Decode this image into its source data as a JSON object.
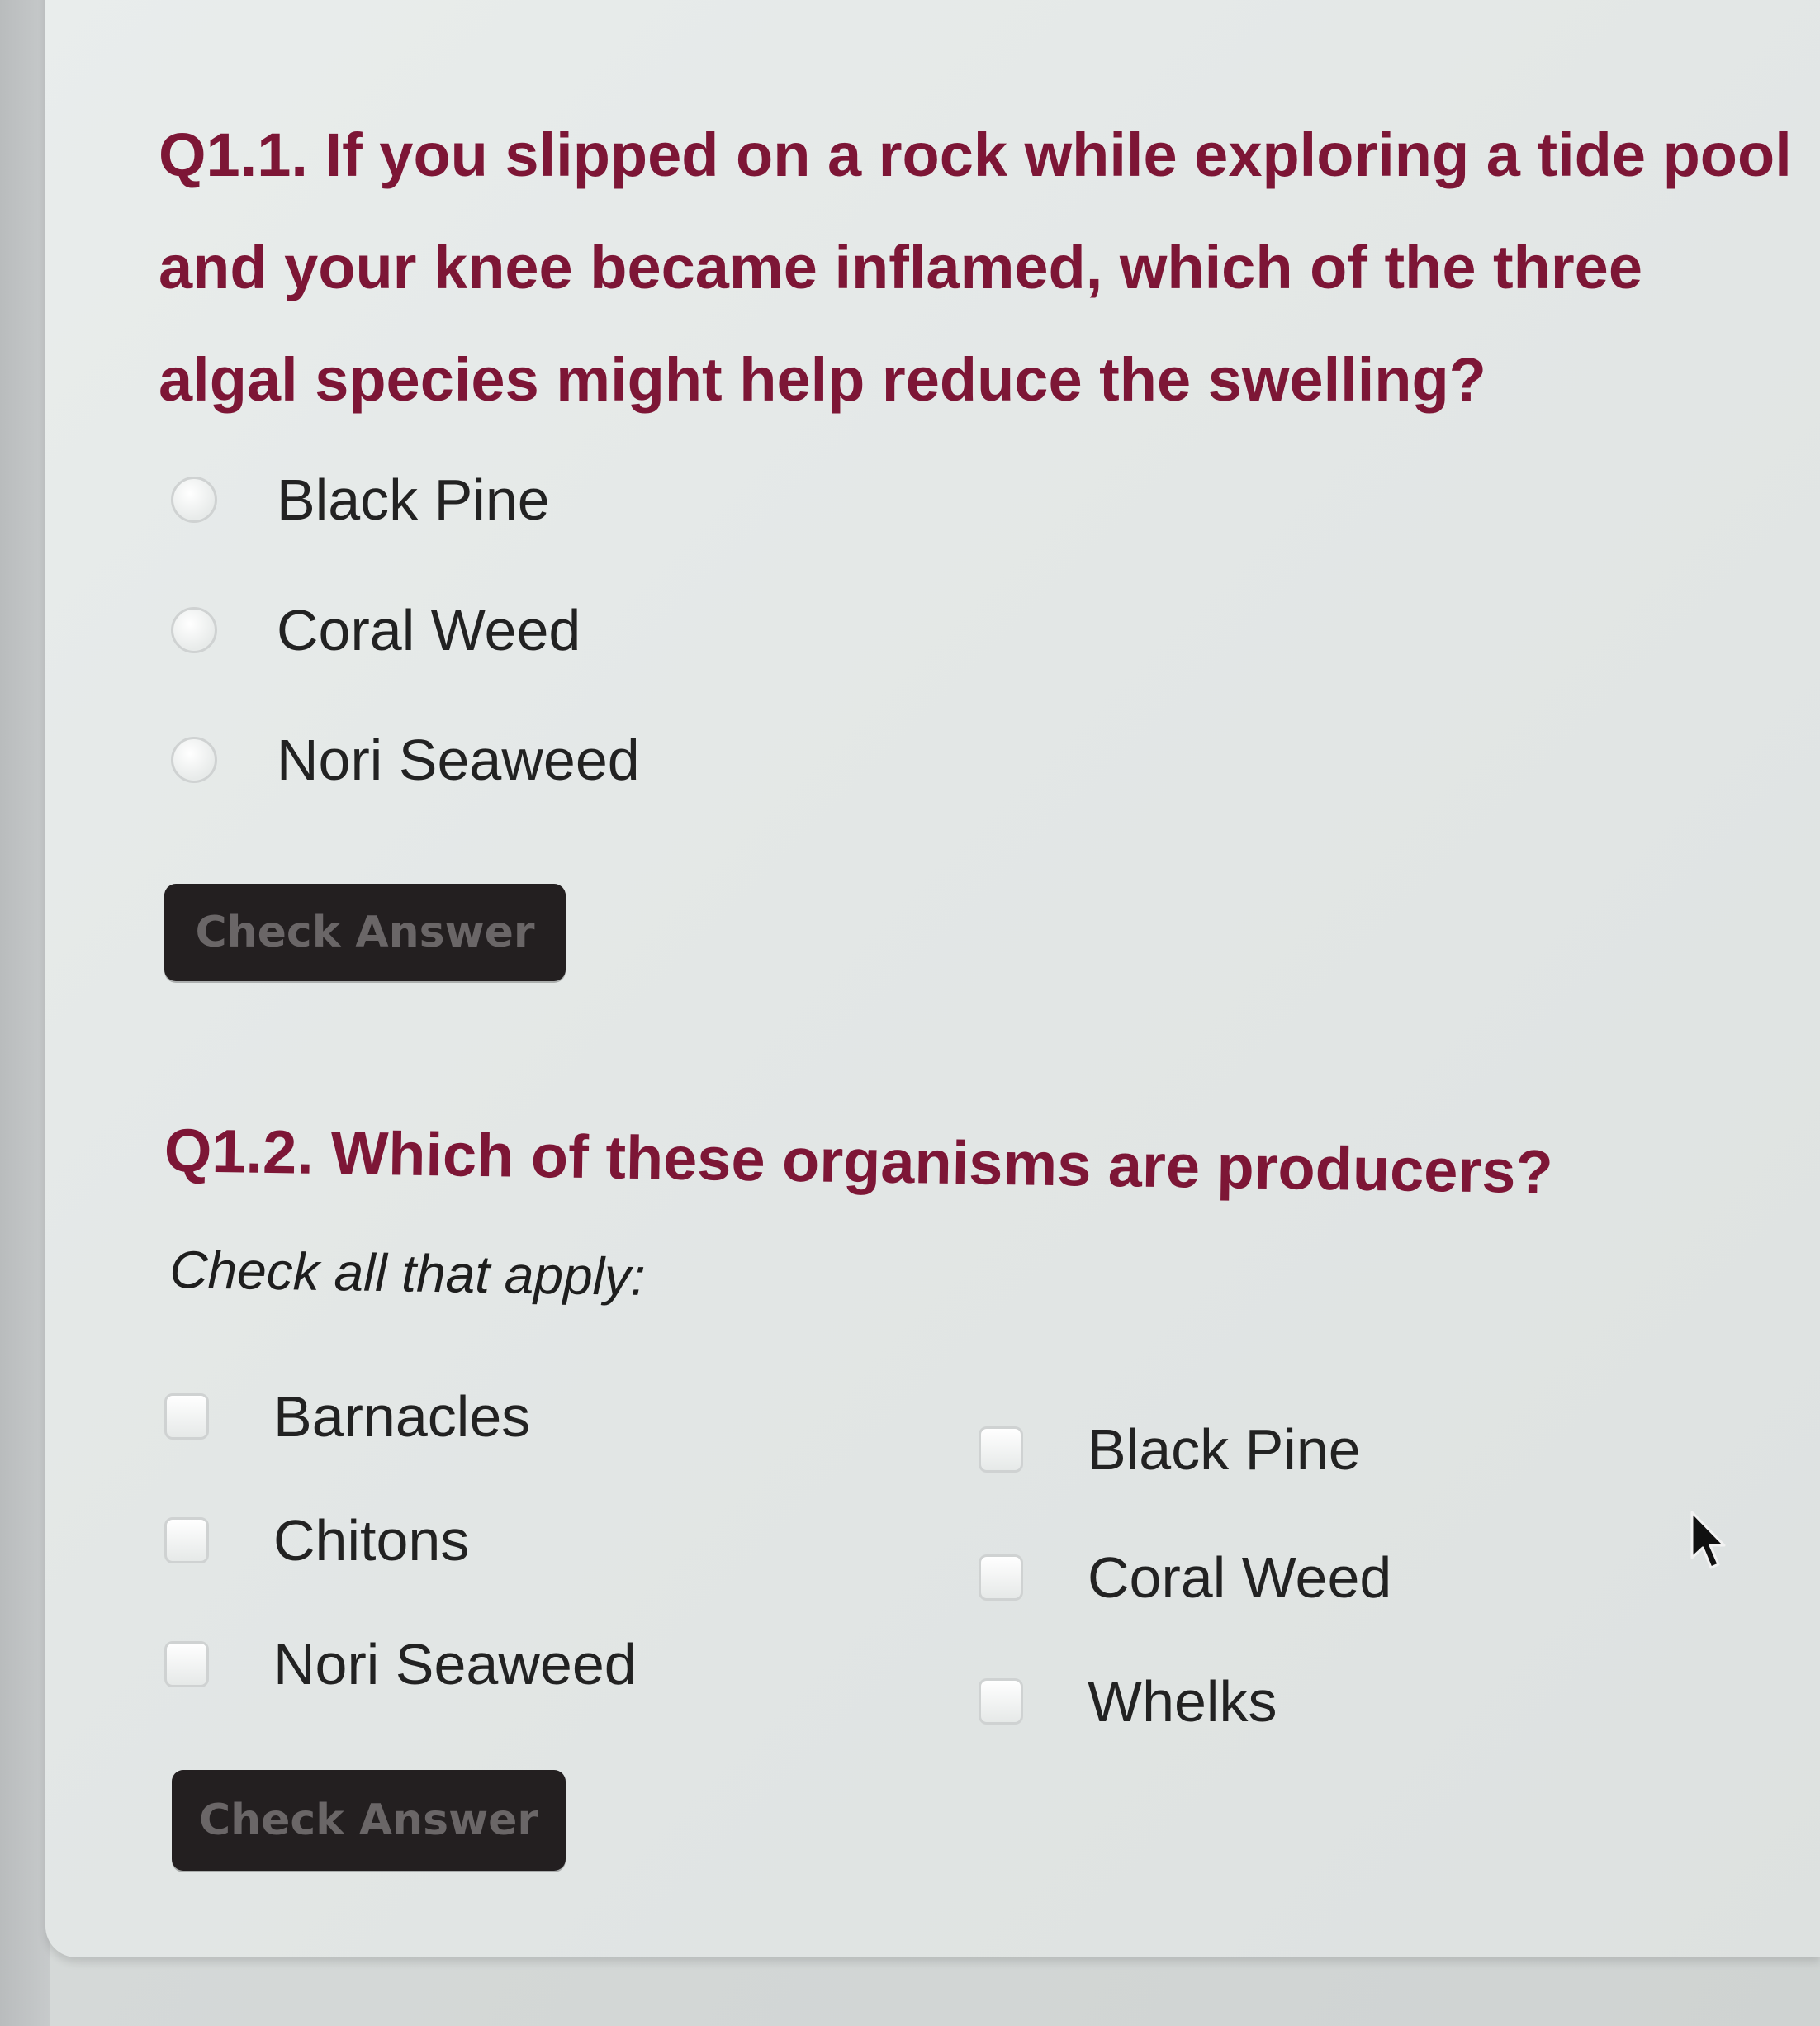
{
  "q1": {
    "title": "Q1.1. If you slipped on a rock while exploring a tide pool and your knee became inflamed, which of the three algal species might help reduce the swelling?",
    "options": [
      "Black Pine",
      "Coral Weed",
      "Nori Seaweed"
    ],
    "button_label": "Check Answer"
  },
  "q2": {
    "title": "Q1.2. Which of these organisms are producers?",
    "instruction": "Check all that apply:",
    "options_left": [
      "Barnacles",
      "Chitons",
      "Nori Seaweed"
    ],
    "options_right": [
      "Black Pine",
      "Coral Weed",
      "Whelks"
    ],
    "button_label": "Check Answer"
  },
  "colors": {
    "question_text": "#7d1636",
    "button_bg": "#231f20",
    "button_text": "#6a6667"
  },
  "icons": {
    "cursor": "arrow-cursor-icon"
  }
}
